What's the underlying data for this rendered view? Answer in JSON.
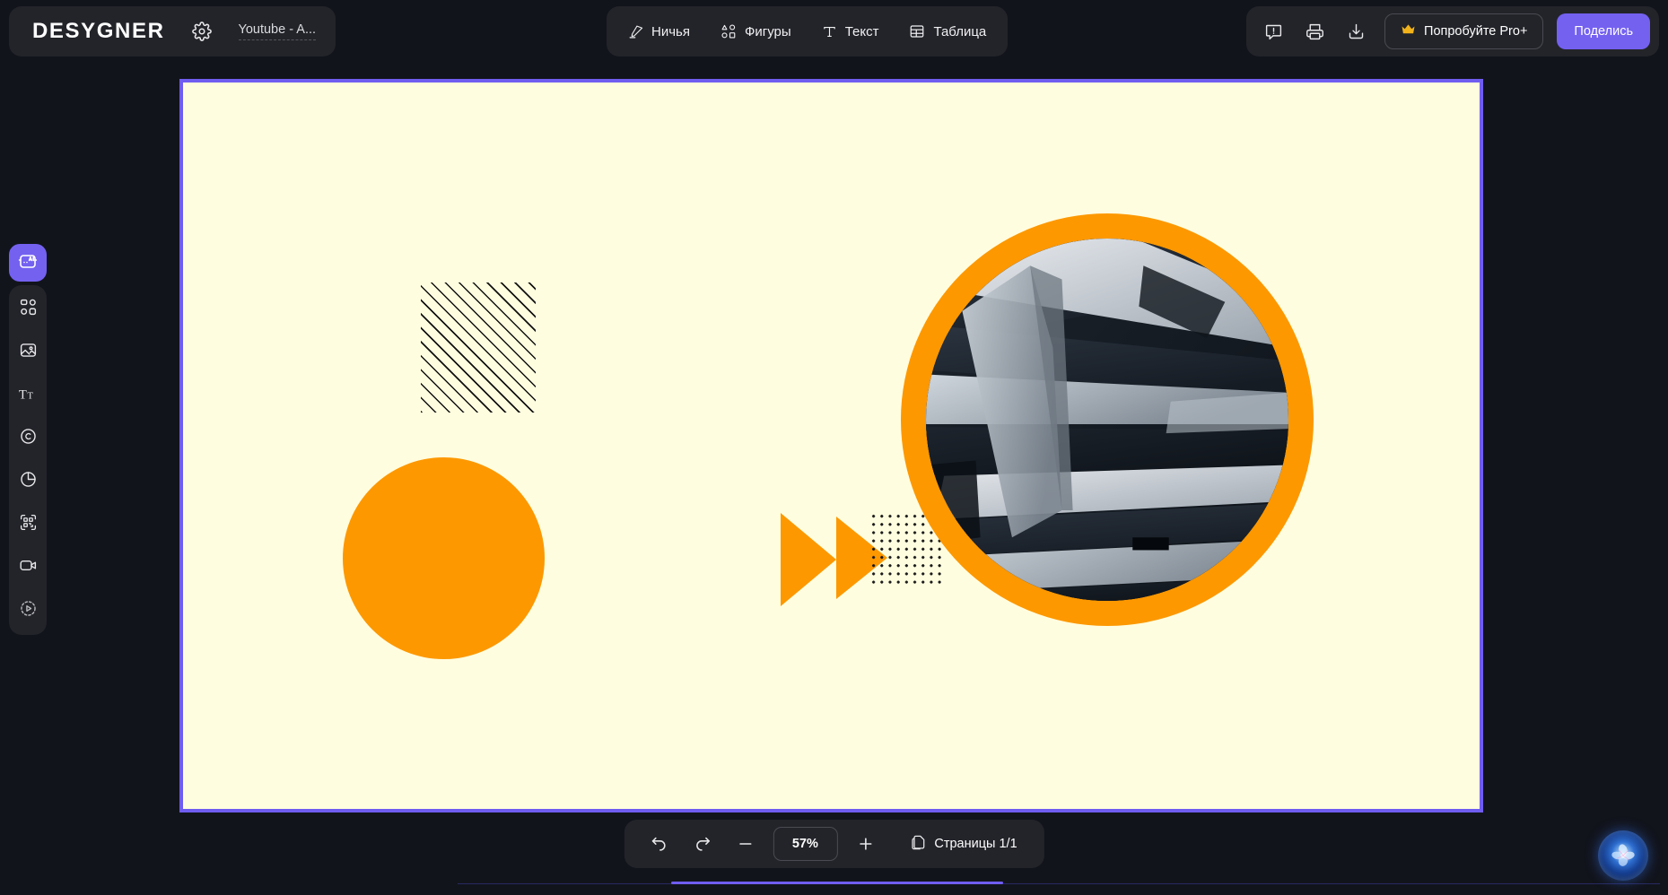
{
  "app": {
    "logo": "DESYGNER",
    "document_title": "Youtube - A...",
    "background_color": "#12141c",
    "panel_color": "#23242a",
    "accent_purple": "#7461f0",
    "accent_orange": "#fd9800",
    "canvas_color": "#fffddf"
  },
  "topbar": {
    "gear_icon": "gear-icon",
    "tools": [
      {
        "label": "Ничья",
        "icon": "draw-pen-icon"
      },
      {
        "label": "Фигуры",
        "icon": "shapes-icon"
      },
      {
        "label": "Текст",
        "icon": "text-icon"
      },
      {
        "label": "Таблица",
        "icon": "table-icon"
      }
    ],
    "right_icons": [
      {
        "name": "feedback-icon",
        "title": "Feedback"
      },
      {
        "name": "print-icon",
        "title": "Print"
      },
      {
        "name": "download-icon",
        "title": "Download"
      }
    ],
    "pro_button": {
      "label": "Попробуйте Pro+",
      "icon": "crown-icon"
    },
    "share_button": {
      "label": "Поделись"
    }
  },
  "sidebar": {
    "items": [
      {
        "name": "sidebar-item-ai",
        "icon": "ai-icon",
        "active": true
      },
      {
        "name": "sidebar-item-templates",
        "icon": "grid-icon",
        "active": false
      },
      {
        "name": "sidebar-item-images",
        "icon": "image-icon",
        "active": false
      },
      {
        "name": "sidebar-item-text",
        "icon": "text-tt-icon",
        "active": false
      },
      {
        "name": "sidebar-item-brand",
        "icon": "copyright-icon",
        "active": false
      },
      {
        "name": "sidebar-item-charts",
        "icon": "pie-chart-icon",
        "active": false
      },
      {
        "name": "sidebar-item-qrcode",
        "icon": "qr-code-icon",
        "active": false
      },
      {
        "name": "sidebar-item-video",
        "icon": "video-icon",
        "active": false
      },
      {
        "name": "sidebar-item-animation",
        "icon": "play-dashed-icon",
        "active": false
      }
    ]
  },
  "canvas": {
    "objects": [
      {
        "name": "hatched-rectangle",
        "type": "pattern-rect",
        "pattern": "diagonal-lines"
      },
      {
        "name": "orange-circle",
        "type": "circle",
        "color": "#fd9800"
      },
      {
        "name": "arrow-triangle-1",
        "type": "triangle",
        "color": "#fd9800"
      },
      {
        "name": "arrow-triangle-2",
        "type": "triangle",
        "color": "#fd9800"
      },
      {
        "name": "dotted-grid",
        "type": "pattern-rect",
        "pattern": "dots"
      },
      {
        "name": "circular-photo",
        "type": "image-circle",
        "ring_color": "#fd9800",
        "subject": "architecture-facade"
      }
    ]
  },
  "bottombar": {
    "undo_icon": "undo-icon",
    "redo_icon": "redo-icon",
    "zoom_out_icon": "minus-icon",
    "zoom_level": "57%",
    "zoom_in_icon": "plus-icon",
    "pages_icon": "pages-icon",
    "pages_label": "Страницы 1/1"
  },
  "assistant": {
    "name": "ai-assistant-orb"
  }
}
